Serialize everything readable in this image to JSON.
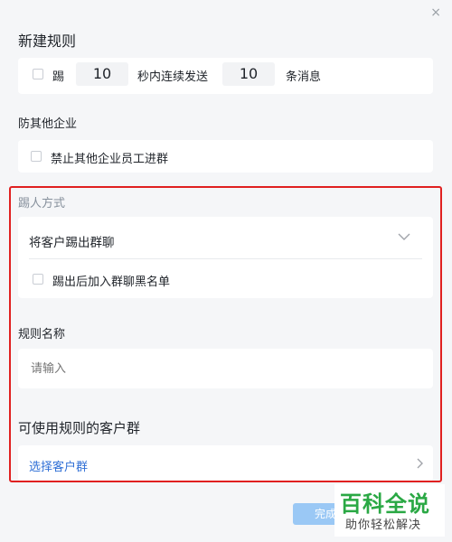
{
  "dialog": {
    "close_glyph": "×",
    "title": "新建规则"
  },
  "frequency_rule": {
    "kick_label": "踢",
    "seconds_value": "10",
    "middle_text": "秒内连续发送",
    "message_count_value": "10",
    "suffix_text": "条消息"
  },
  "prevent_other_company": {
    "section_label": "防其他企业",
    "checkbox_label": "禁止其他企业员工进群"
  },
  "kick_method": {
    "section_label": "踢人方式",
    "selected_option": "将客户踢出群聊",
    "blacklist_label": "踢出后加入群聊黑名单"
  },
  "rule_name": {
    "section_label": "规则名称",
    "placeholder": "请输入"
  },
  "customer_groups": {
    "section_label": "可使用规则的客户群",
    "select_link": "选择客户群"
  },
  "footer": {
    "done_label": "完成"
  },
  "watermark": {
    "title": "百科全说",
    "subtitle": "助你轻松解决"
  },
  "colors": {
    "link_blue": "#2f6fd6",
    "highlight_red": "#e02020",
    "watermark_green": "#2aa844"
  }
}
